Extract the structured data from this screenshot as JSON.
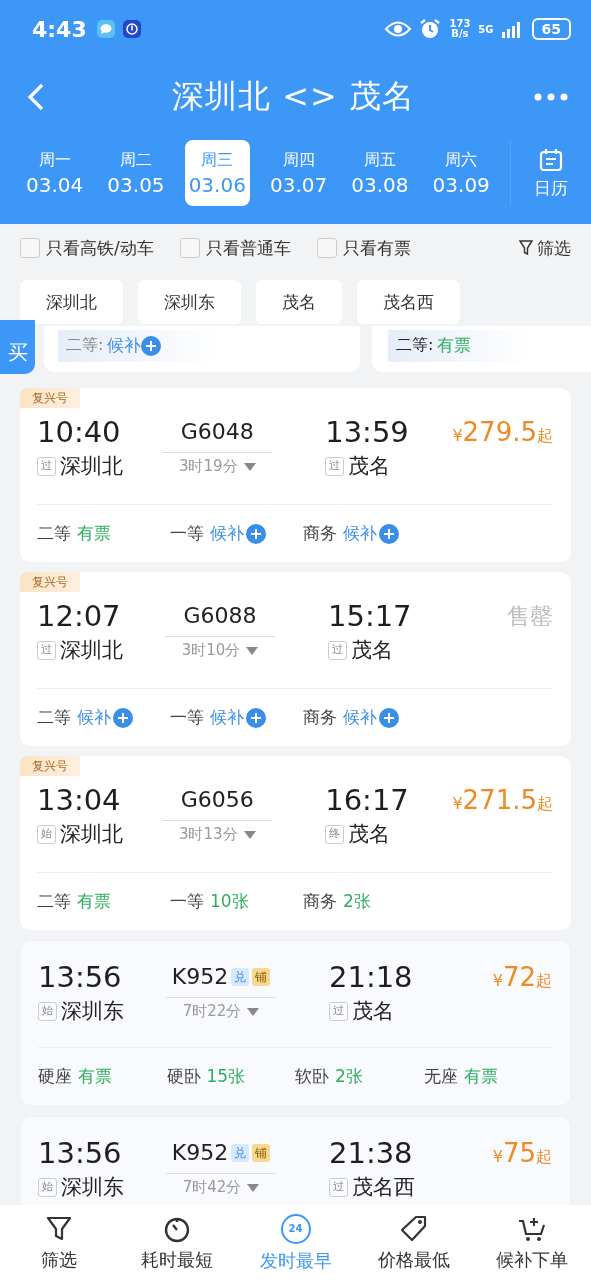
{
  "status_bar": {
    "time": "4:43",
    "speed": "173",
    "speed_unit": "B/s",
    "network": "5G",
    "battery": "65"
  },
  "header": {
    "title": "深圳北 <> 茂名"
  },
  "dates": [
    {
      "weekday": "周一",
      "date": "03.04",
      "selected": false
    },
    {
      "weekday": "周二",
      "date": "03.05",
      "selected": false
    },
    {
      "weekday": "周三",
      "date": "03.06",
      "selected": true
    },
    {
      "weekday": "周四",
      "date": "03.07",
      "selected": false
    },
    {
      "weekday": "周五",
      "date": "03.08",
      "selected": false
    },
    {
      "weekday": "周六",
      "date": "03.09",
      "selected": false
    }
  ],
  "calendar_label": "日历",
  "filters": [
    {
      "label": "只看高铁/动车",
      "checked": false
    },
    {
      "label": "只看普通车",
      "checked": false
    },
    {
      "label": "只看有票",
      "checked": false
    }
  ],
  "filter_button": "筛选",
  "stations": [
    {
      "label": "深圳北"
    },
    {
      "label": "深圳东"
    },
    {
      "label": "茂名"
    },
    {
      "label": "茂名西"
    }
  ],
  "peek": {
    "side_tab": "买",
    "cards": [
      {
        "seat": "二等:",
        "status": "候补",
        "kind": "waitlist"
      },
      {
        "seat": "二等:",
        "status": "有票",
        "kind": "available"
      }
    ]
  },
  "trains": [
    {
      "badge": "复兴号",
      "tinted": false,
      "depart": "10:40",
      "train_no": "G6048",
      "arrive": "13:59",
      "from_tag": "过",
      "from": "深圳北",
      "duration": "3时19分",
      "to_tag": "过",
      "to": "茂名",
      "price": {
        "kind": "price",
        "symbol": "¥",
        "amount": "279.5",
        "suffix": "起"
      },
      "seats": [
        {
          "class": "二等",
          "status": "有票",
          "kind": "available"
        },
        {
          "class": "一等",
          "status": "候补",
          "kind": "waitlist"
        },
        {
          "class": "商务",
          "status": "候补",
          "kind": "waitlist"
        }
      ]
    },
    {
      "badge": "复兴号",
      "tinted": false,
      "depart": "12:07",
      "train_no": "G6088",
      "arrive": "15:17",
      "from_tag": "过",
      "from": "深圳北",
      "duration": "3时10分",
      "to_tag": "过",
      "to": "茂名",
      "price": {
        "kind": "sold_out",
        "text": "售罄"
      },
      "seats": [
        {
          "class": "二等",
          "status": "候补",
          "kind": "waitlist"
        },
        {
          "class": "一等",
          "status": "候补",
          "kind": "waitlist"
        },
        {
          "class": "商务",
          "status": "候补",
          "kind": "waitlist"
        }
      ]
    },
    {
      "badge": "复兴号",
      "tinted": false,
      "depart": "13:04",
      "train_no": "G6056",
      "arrive": "16:17",
      "from_tag": "始",
      "from": "深圳北",
      "duration": "3时13分",
      "to_tag": "终",
      "to": "茂名",
      "price": {
        "kind": "price",
        "symbol": "¥",
        "amount": "271.5",
        "suffix": "起"
      },
      "seats": [
        {
          "class": "二等",
          "status": "有票",
          "kind": "available"
        },
        {
          "class": "一等",
          "status": "10张",
          "kind": "available"
        },
        {
          "class": "商务",
          "status": "2张",
          "kind": "available"
        }
      ]
    },
    {
      "tinted": true,
      "depart": "13:56",
      "train_no": "K952",
      "tags": [
        {
          "label": "兑",
          "kind": "exchange"
        },
        {
          "label": "铺",
          "kind": "berth"
        }
      ],
      "arrive": "21:18",
      "from_tag": "始",
      "from": "深圳东",
      "duration": "7时22分",
      "to_tag": "过",
      "to": "茂名",
      "price": {
        "kind": "price",
        "symbol": "¥",
        "amount": "72",
        "suffix": "起"
      },
      "seats": [
        {
          "class": "硬座",
          "status": "有票",
          "kind": "available"
        },
        {
          "class": "硬卧",
          "status": "15张",
          "kind": "available"
        },
        {
          "class": "软卧",
          "status": "2张",
          "kind": "available"
        },
        {
          "class": "无座",
          "status": "有票",
          "kind": "available"
        }
      ]
    },
    {
      "tinted": true,
      "depart": "13:56",
      "train_no": "K952",
      "tags": [
        {
          "label": "兑",
          "kind": "exchange"
        },
        {
          "label": "铺",
          "kind": "berth"
        }
      ],
      "arrive": "21:38",
      "from_tag": "始",
      "from": "深圳东",
      "duration": "7时42分",
      "to_tag": "过",
      "to": "茂名西",
      "price": {
        "kind": "price",
        "symbol": "¥",
        "amount": "75",
        "suffix": "起"
      }
    }
  ],
  "bottom_nav": [
    {
      "label": "筛选",
      "selected": false
    },
    {
      "label": "耗时最短",
      "selected": false
    },
    {
      "label": "发时最早",
      "selected": true,
      "icon_text": "24"
    },
    {
      "label": "价格最低",
      "selected": false
    },
    {
      "label": "候补下单",
      "selected": false
    }
  ]
}
